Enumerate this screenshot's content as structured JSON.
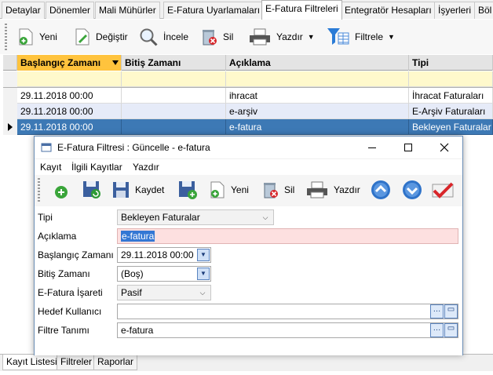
{
  "tabs": [
    "Detaylar",
    "Dönemler",
    "Mali Mühürler",
    "E-Fatura Uyarlamaları",
    "E-Fatura Filtreleri",
    "Entegratör Hesapları",
    "İşyerleri",
    "Böl"
  ],
  "active_tab": "E-Fatura Filtreleri",
  "toolbar": {
    "yeni": "Yeni",
    "degistir": "Değiştir",
    "incele": "İncele",
    "sil": "Sil",
    "yazdir": "Yazdır",
    "filtrele": "Filtrele"
  },
  "grid": {
    "columns": [
      "Başlangıç Zamanı",
      "Bitiş Zamanı",
      "Açıklama",
      "Tipi"
    ],
    "rows": [
      [
        "29.11.2018 00:00",
        "",
        "ihracat",
        "İhracat Faturaları"
      ],
      [
        "29.11.2018 00:00",
        "",
        "e-arşiv",
        "E-Arşiv Faturaları"
      ],
      [
        "29.11.2018 00:00",
        "",
        "e-fatura",
        "Bekleyen Faturalar"
      ]
    ]
  },
  "bottom_tabs": [
    "Kayıt Listesi",
    "Filtreler",
    "Raporlar"
  ],
  "dialog": {
    "title": "E-Fatura Filtresi : Güncelle - e-fatura",
    "menu": [
      "Kayıt",
      "İlgili Kayıtlar",
      "Yazdır"
    ],
    "toolbar": {
      "kaydet": "Kaydet",
      "yeni": "Yeni",
      "sil": "Sil",
      "yazdir": "Yazdır"
    },
    "fields": {
      "tipi_label": "Tipi",
      "tipi_value": "Bekleyen Faturalar",
      "aciklama_label": "Açıklama",
      "aciklama_value": "e-fatura",
      "baslangic_label": "Başlangıç Zamanı",
      "baslangic_value": "29.11.2018 00:00",
      "bitis_label": "Bitiş Zamanı",
      "bitis_value": "(Boş)",
      "isaret_label": "E-Fatura İşareti",
      "isaret_value": "Pasif",
      "hedef_label": "Hedef Kullanıcı",
      "hedef_value": "",
      "filtre_label": "Filtre Tanımı",
      "filtre_value": "e-fatura"
    }
  },
  "colors": {
    "selected_row": "#3d79b5",
    "sorted_header": "#ffc33d",
    "filter_row": "#fff9cc",
    "alt_row": "#e6ebf8",
    "required_field": "#fde0e0"
  }
}
